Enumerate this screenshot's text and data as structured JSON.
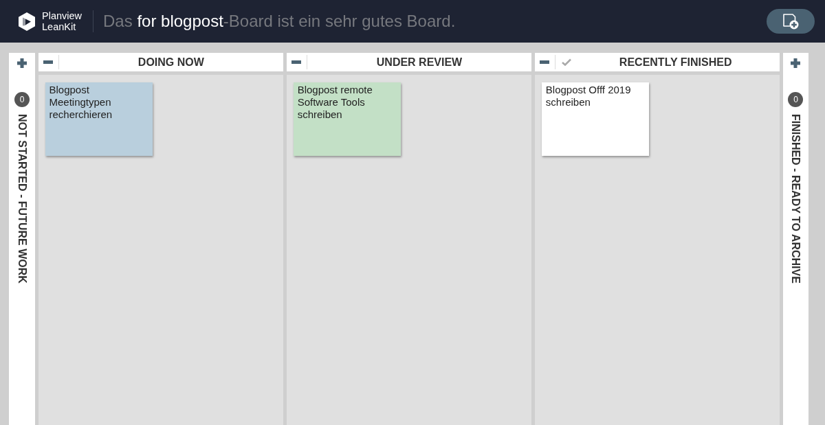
{
  "header": {
    "brand": [
      "Planview",
      "LeanKit"
    ],
    "board_title": [
      {
        "text": "Das ",
        "emphasis": false
      },
      {
        "text": "for blogpost",
        "emphasis": true
      },
      {
        "text": "-Board ist ein sehr gutes Board.",
        "emphasis": false
      }
    ]
  },
  "lanes": [
    {
      "kind": "collapsed",
      "title": "NOT STARTED - FUTURE WORK",
      "count": "0"
    },
    {
      "kind": "column",
      "title": "DOING NOW",
      "completed": false,
      "cards": [
        {
          "title": "Blogpost Meetingtypen recherchieren",
          "color": "#b9cfdd"
        }
      ]
    },
    {
      "kind": "column",
      "title": "UNDER REVIEW",
      "completed": false,
      "cards": [
        {
          "title": "Blogpost remote Software Tools schreiben",
          "color": "#c3e0c6"
        }
      ]
    },
    {
      "kind": "column",
      "title": "RECENTLY FINISHED",
      "completed": true,
      "cards": [
        {
          "title": "Blogpost Offf 2019 schreiben",
          "color": "#ffffff"
        }
      ]
    },
    {
      "kind": "collapsed",
      "title": "FINISHED - READY TO ARCHIVE",
      "count": "0"
    }
  ]
}
